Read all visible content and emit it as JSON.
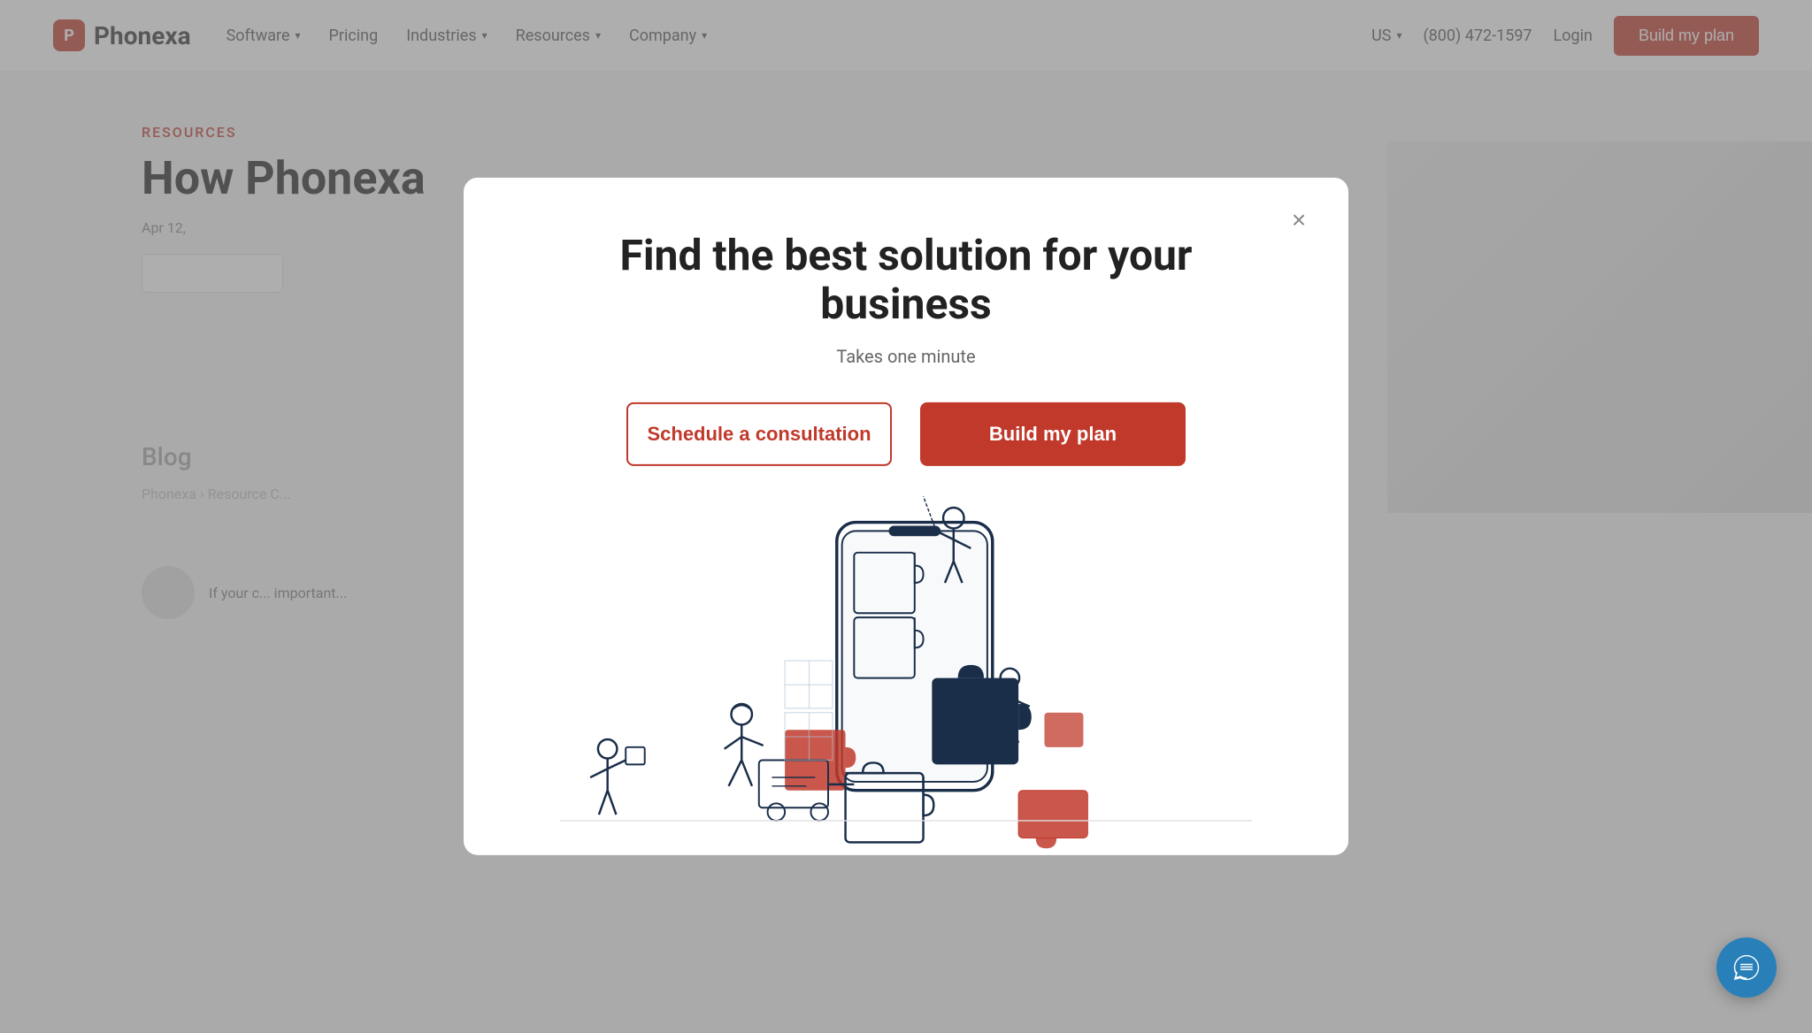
{
  "site": {
    "logo_text": "Phonexa",
    "logo_icon": "P"
  },
  "navbar": {
    "links": [
      {
        "label": "Software",
        "has_dropdown": true
      },
      {
        "label": "Pricing",
        "has_dropdown": false
      },
      {
        "label": "Industries",
        "has_dropdown": true
      },
      {
        "label": "Resources",
        "has_dropdown": true
      },
      {
        "label": "Company",
        "has_dropdown": true
      }
    ],
    "region": "US",
    "phone": "(800) 472-1597",
    "login_label": "Login",
    "cta_label": "Build my plan"
  },
  "bg_content": {
    "resources_label": "RESOURCES",
    "blog_title": "How Phonexa",
    "date": "Apr 12,",
    "blog_label": "Blog",
    "breadcrumb": "Phonexa › Resource C...",
    "body_text": "If your c... important..."
  },
  "modal": {
    "close_label": "×",
    "title": "Find the best solution for your business",
    "subtitle": "Takes one minute",
    "btn_consultation_label": "Schedule a consultation",
    "btn_plan_label": "Build my plan"
  },
  "chat": {
    "icon": "chat"
  },
  "colors": {
    "brand_red": "#c0392b",
    "brand_blue": "#2980b9",
    "text_dark": "#222222",
    "text_medium": "#666666",
    "outline_btn_border": "#c0392b"
  }
}
